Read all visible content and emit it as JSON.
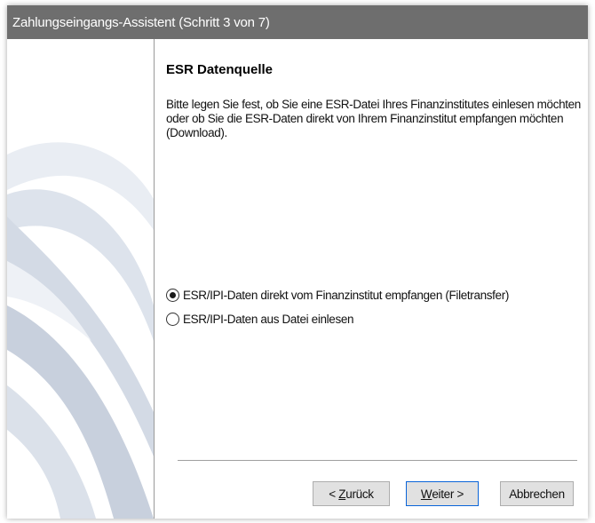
{
  "window": {
    "title": "Zahlungseingangs-Assistent (Schritt 3 von 7)"
  },
  "page": {
    "heading": "ESR Datenquelle",
    "description": "Bitte legen Sie fest, ob Sie eine ESR-Datei Ihres Finanzinstitutes einlesen möchten oder ob Sie die ESR-Daten direkt von Ihrem Finanzinstitut empfangen möchten (Download)."
  },
  "options": [
    {
      "label": "ESR/IPI-Daten direkt vom Finanzinstitut empfangen (Filetransfer)",
      "selected": true
    },
    {
      "label": "ESR/IPI-Daten aus Datei einlesen",
      "selected": false
    }
  ],
  "buttons": {
    "back_prefix": "< ",
    "back_mnemonic": "Z",
    "back_rest": "urück",
    "next_mnemonic": "W",
    "next_rest": "eiter >",
    "cancel": "Abbrechen"
  },
  "colors": {
    "titlebar": "#6e6e6e",
    "focus_border": "#0a64d8",
    "button_face": "#e1e1e1"
  }
}
